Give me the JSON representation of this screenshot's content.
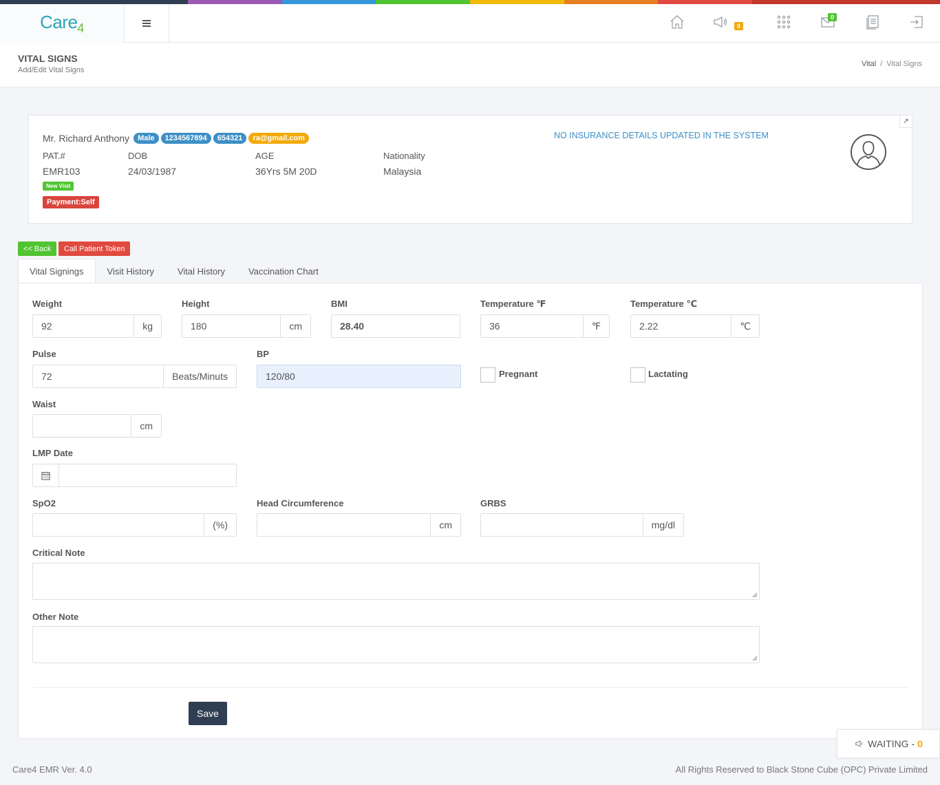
{
  "colors": {
    "strip": [
      "#2f3e52",
      "#9b59b6",
      "#3498db",
      "#51c431",
      "#f2b90a",
      "#e67e22",
      "#e04a3f",
      "#c0392b"
    ],
    "green": "#51c431",
    "red": "#e04a3f",
    "blue_pill": "#3d8fc6",
    "orange_pill": "#f2a90a",
    "navy": "#2f3e52"
  },
  "header": {
    "logo_main": "Care",
    "logo_sub": "4",
    "notifications_count": "0",
    "messages_count": "0",
    "icons": [
      "home-icon",
      "megaphone-icon",
      "apps-grid-icon",
      "mail-icon",
      "report-icon",
      "logout-icon"
    ]
  },
  "page": {
    "title": "VITAL SIGNS",
    "subtitle": "Add/Edit Vital Signs",
    "breadcrumb": [
      "Vital",
      "Vital Signs"
    ]
  },
  "patient": {
    "name": "Mr. Richard Anthony",
    "gender": "Male",
    "phone": "1234567894",
    "id_number": "654321",
    "email": "ra@gmail.com",
    "labels": {
      "pat": "PAT.#",
      "dob": "DOB",
      "age": "AGE",
      "nationality": "Nationality"
    },
    "pat_no": "EMR103",
    "dob": "24/03/1987",
    "age": "36Yrs 5M 20D",
    "nationality": "Malaysia",
    "visit_tag": "New Visit",
    "payment_tag": "Payment:Self",
    "insurance_notice": "NO INSURANCE DETAILS UPDATED IN THE SYSTEM"
  },
  "actions": {
    "back": "<< Back",
    "call_token": "Call Patient Token"
  },
  "tabs": [
    "Vital Signings",
    "Visit History",
    "Vital History",
    "Vaccination Chart"
  ],
  "form": {
    "weight": {
      "label": "Weight",
      "value": "92",
      "unit": "kg"
    },
    "height": {
      "label": "Height",
      "value": "180",
      "unit": "cm"
    },
    "bmi": {
      "label": "BMI",
      "value": "28.40"
    },
    "temp_f": {
      "label": "Temperature ℉",
      "value": "36",
      "unit": "℉"
    },
    "temp_c": {
      "label": "Temperature ℃",
      "value": "2.22",
      "unit": "℃"
    },
    "pulse": {
      "label": "Pulse",
      "value": "72",
      "unit": "Beats/Minuts"
    },
    "bp": {
      "label": "BP",
      "value": "120/80"
    },
    "pregnant": {
      "label": "Pregnant",
      "checked": false
    },
    "lactating": {
      "label": "Lactating",
      "checked": false
    },
    "waist": {
      "label": "Waist",
      "value": "",
      "unit": "cm"
    },
    "lmp": {
      "label": "LMP Date",
      "value": ""
    },
    "spo2": {
      "label": "SpO2",
      "value": "",
      "unit": "(%)"
    },
    "head_circ": {
      "label": "Head Circumference",
      "value": "",
      "unit": "cm"
    },
    "grbs": {
      "label": "GRBS",
      "value": "",
      "unit": "mg/dl"
    },
    "critical_note": {
      "label": "Critical Note",
      "value": ""
    },
    "other_note": {
      "label": "Other Note",
      "value": ""
    },
    "save": "Save"
  },
  "footer": {
    "version": "Care4 EMR Ver. 4.0",
    "rights": "All Rights Reserved to Black Stone Cube (OPC) Private Limited",
    "waiting_label": "WAITING -",
    "waiting_count": "0"
  }
}
